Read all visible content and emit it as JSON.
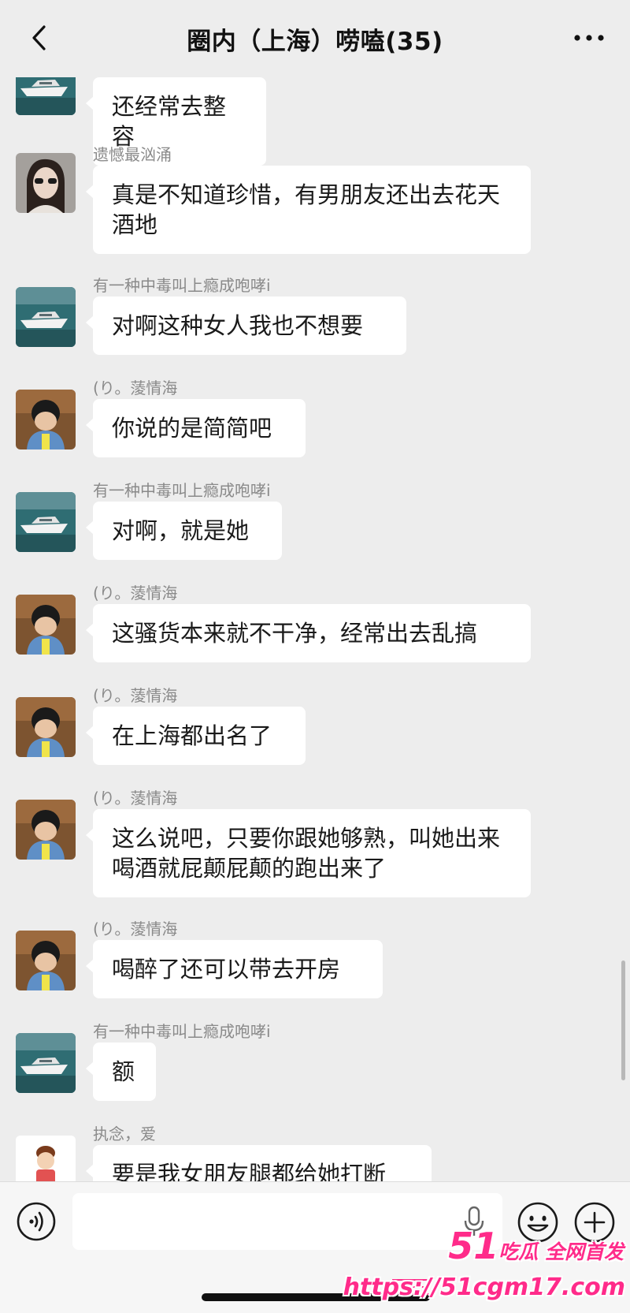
{
  "header": {
    "title": "圈内（上海）唠嗑(35)",
    "back_icon": "chevron-left-icon",
    "more_icon": "more-dots-icon"
  },
  "messages": [
    {
      "sender": "",
      "avatar": "yacht",
      "text": "还经常去整容"
    },
    {
      "sender": "遗憾最汹涌",
      "avatar": "woman",
      "text": "真是不知道珍惜，有男朋友还出去花天酒地"
    },
    {
      "sender": "有一种中毒叫上瘾成咆哮i",
      "avatar": "yacht",
      "text": "对啊这种女人我也不想要"
    },
    {
      "sender": "(り。蔆情海",
      "avatar": "child",
      "text": "你说的是简简吧"
    },
    {
      "sender": "有一种中毒叫上瘾成咆哮i",
      "avatar": "yacht",
      "text": "对啊，就是她"
    },
    {
      "sender": "(り。蔆情海",
      "avatar": "child",
      "text": "这骚货本来就不干净，经常出去乱搞"
    },
    {
      "sender": "(り。蔆情海",
      "avatar": "child",
      "text": "在上海都出名了"
    },
    {
      "sender": "(り。蔆情海",
      "avatar": "child",
      "text": "这么说吧，只要你跟她够熟，叫她出来喝酒就屁颠屁颠的跑出来了"
    },
    {
      "sender": "(り。蔆情海",
      "avatar": "child",
      "text": "喝醉了还可以带去开房"
    },
    {
      "sender": "有一种中毒叫上瘾成咆哮i",
      "avatar": "yacht",
      "text": "额"
    },
    {
      "sender": "执念，爱",
      "avatar": "cartoon",
      "text": "要是我女朋友腿都给她打断"
    }
  ],
  "input_bar": {
    "value": "",
    "voice_icon": "voice-icon",
    "mic_icon": "microphone-icon",
    "emoji_icon": "emoji-icon",
    "plus_icon": "plus-icon"
  },
  "watermark": {
    "number": "51",
    "text": "吃瓜 全网首发",
    "url": "https://51cgm17.com"
  },
  "colors": {
    "background": "#ededed",
    "bubble": "#ffffff",
    "sender_text": "#8a8a8a",
    "watermark": "#ff2b8a"
  }
}
